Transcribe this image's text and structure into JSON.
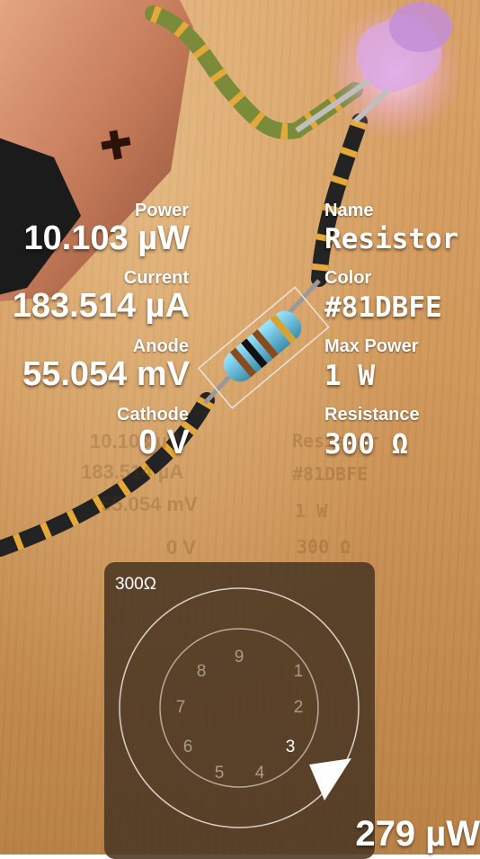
{
  "component_info": {
    "power_label": "Power",
    "power_value": "10.103 µW",
    "current_label": "Current",
    "current_value": "183.514 µA",
    "anode_label": "Anode",
    "anode_value": "55.054 mV",
    "cathode_label": "Cathode",
    "cathode_value": "0 V",
    "name_label": "Name",
    "name_value": "Resistor",
    "color_label": "Color",
    "color_value": "#81DBFE",
    "max_power_label": "Max Power",
    "max_power_value": "1 W",
    "resistance_label": "Resistance",
    "resistance_value": "300 Ω"
  },
  "dial": {
    "display_value": "300Ω",
    "digits": [
      "1",
      "2",
      "3",
      "4",
      "5",
      "6",
      "7",
      "8",
      "9"
    ],
    "selected_digit": "3"
  },
  "footer": {
    "power_readout": "279 µW"
  },
  "colors": {
    "panel": "#4b3723",
    "resistor_body": "#81DBFE",
    "battery_copper": "#c9805d",
    "led": "#d9a8e6"
  }
}
